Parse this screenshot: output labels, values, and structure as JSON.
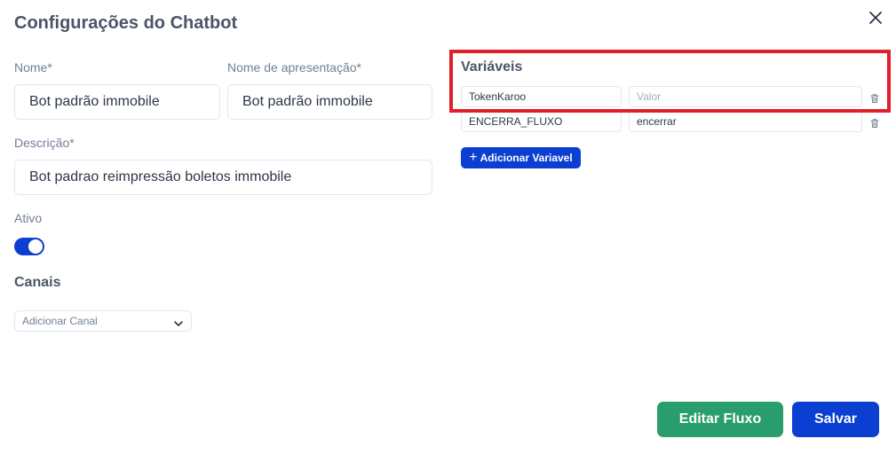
{
  "dialog": {
    "title": "Configurações do Chatbot"
  },
  "form": {
    "name_label": "Nome*",
    "name_value": "Bot padrão immobile",
    "display_name_label": "Nome de apresentação*",
    "display_name_value": "Bot padrão immobile",
    "description_label": "Descrição*",
    "description_value": "Bot padrao reimpressão boletos immobile",
    "active_label": "Ativo",
    "active_value": true
  },
  "channels": {
    "heading": "Canais",
    "select_placeholder": "Adicionar Canal"
  },
  "variables": {
    "heading": "Variáveis",
    "value_placeholder": "Valor",
    "rows": [
      {
        "name": "TokenKaroo",
        "value": ""
      },
      {
        "name": "ENCERRA_FLUXO",
        "value": "encerrar"
      }
    ],
    "add_label": "Adicionar Variavel"
  },
  "actions": {
    "edit_flow_label": "Editar Fluxo",
    "save_label": "Salvar"
  },
  "colors": {
    "primary": "#0b3fd1",
    "success": "#2a9d6e",
    "highlight": "#e01f28"
  }
}
